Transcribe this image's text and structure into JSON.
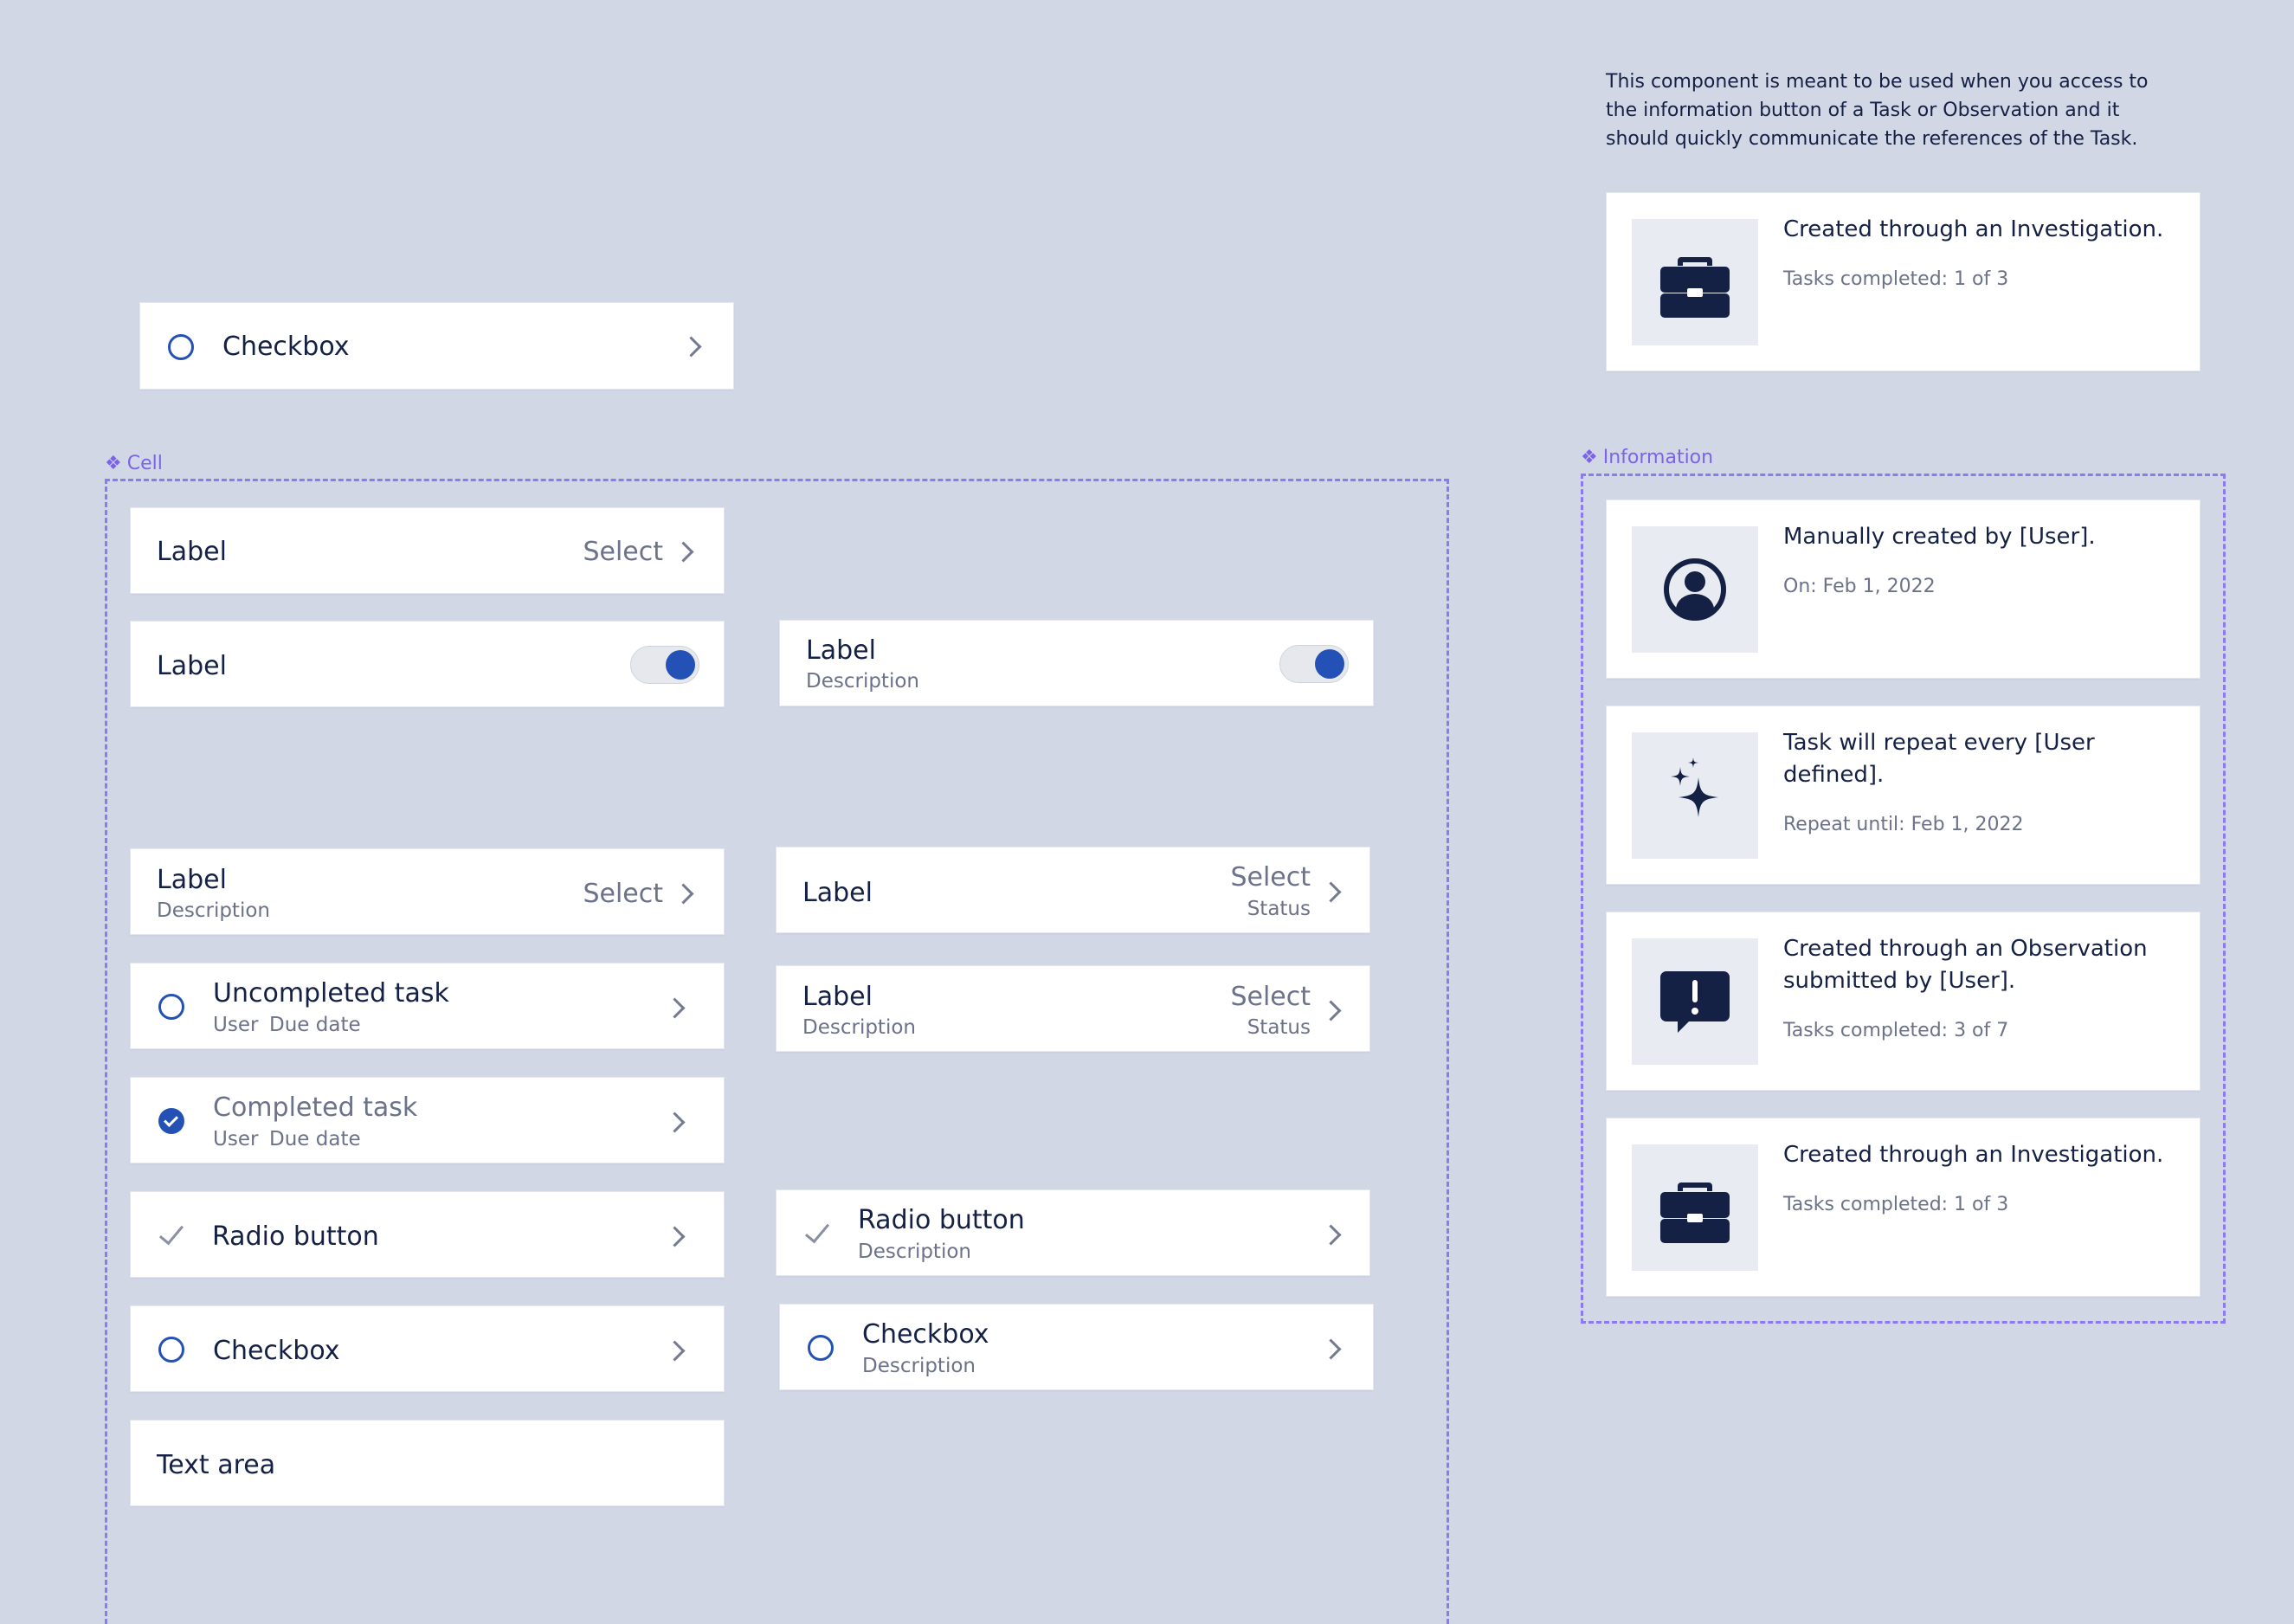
{
  "note": {
    "text": "This component is meant to be used when you access to the information button of a Task or Observation and it should quickly communicate the references of the Task."
  },
  "standalone_checkbox": {
    "label": "Checkbox"
  },
  "top_info_card": {
    "icon": "briefcase-icon",
    "title": "Created through an Investigation.",
    "subtitle": "Tasks completed: 1 of 3"
  },
  "cell_frame": {
    "tag": "Cell",
    "rows": {
      "label_select": {
        "label": "Label",
        "value": "Select"
      },
      "label_toggle": {
        "label": "Label",
        "toggle_on": true
      },
      "label_desc_toggle": {
        "label": "Label",
        "description": "Description",
        "toggle_on": true
      },
      "label_desc_select": {
        "label": "Label",
        "description": "Description",
        "value": "Select"
      },
      "label_select_status": {
        "label": "Label",
        "value": "Select",
        "status": "Status"
      },
      "uncompleted_task": {
        "label": "Uncompleted task",
        "user": "User",
        "due": "Due date"
      },
      "label_desc_select_status": {
        "label": "Label",
        "description": "Description",
        "value": "Select",
        "status": "Status"
      },
      "completed_task": {
        "label": "Completed task",
        "user": "User",
        "due": "Due date"
      },
      "radio_button": {
        "label": "Radio button"
      },
      "radio_button_desc": {
        "label": "Radio button",
        "description": "Description"
      },
      "checkbox": {
        "label": "Checkbox"
      },
      "checkbox_desc": {
        "label": "Checkbox",
        "description": "Description"
      },
      "text_area": {
        "label": "Text area"
      }
    }
  },
  "information_frame": {
    "tag": "Information",
    "cards": [
      {
        "icon": "user-circle-icon",
        "title": "Manually created by [User].",
        "subtitle": "On: Feb 1, 2022"
      },
      {
        "icon": "sparkle-icon",
        "title": "Task will repeat every [User defined].",
        "subtitle": "Repeat until: Feb 1, 2022"
      },
      {
        "icon": "alert-chat-icon",
        "title": "Created through an Observation submitted by [User].",
        "subtitle": "Tasks completed: 3 of 7"
      },
      {
        "icon": "briefcase-icon",
        "title": "Created through an Investigation.",
        "subtitle": "Tasks completed: 1 of 3"
      }
    ]
  },
  "colors": {
    "background": "#d2d7e6",
    "accent": "#2451b6",
    "frame": "#8d79f1",
    "text": "#142044",
    "muted": "#6b7289"
  }
}
